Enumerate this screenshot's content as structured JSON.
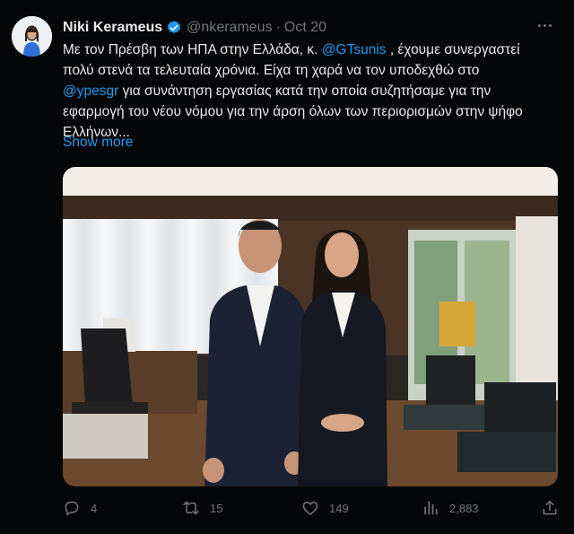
{
  "author": {
    "name": "Niki Kerameus",
    "handle": "@nkerameus",
    "separator": "·",
    "date": "Oct 20"
  },
  "tweet": {
    "line1_prefix": "Με τον Πρέσβη των ΗΠΑ στην Ελλάδα, κ. ",
    "mention1": "@GTsunis",
    "line1_suffix": " , έχουμε συνεργαστεί",
    "line2": "πολύ στενά τα τελευταία χρόνια. Είχα τη χαρά να τον υποδεχθώ στο",
    "mention2": "@ypesgr",
    "line3_suffix": " για συνάντηση εργασίας κατά την οποία συζητήσαμε για την",
    "line4": "εφαρμογή του νέου νόμου για την άρση όλων των περιορισμών στην ψήφο",
    "line5": "Ελλήνων...",
    "show_more": "Show more"
  },
  "actions": {
    "replies": "4",
    "retweets": "15",
    "likes": "149",
    "views": "2,883"
  },
  "icons": {
    "verified": "verified-badge-icon",
    "more": "more-options-icon",
    "reply": "reply-icon",
    "retweet": "retweet-icon",
    "like": "heart-icon",
    "views": "analytics-icon",
    "share": "share-icon"
  },
  "colors": {
    "background": "#050607",
    "text": "#e7e9ea",
    "muted": "#71767b",
    "accent": "#1d9bf0"
  }
}
